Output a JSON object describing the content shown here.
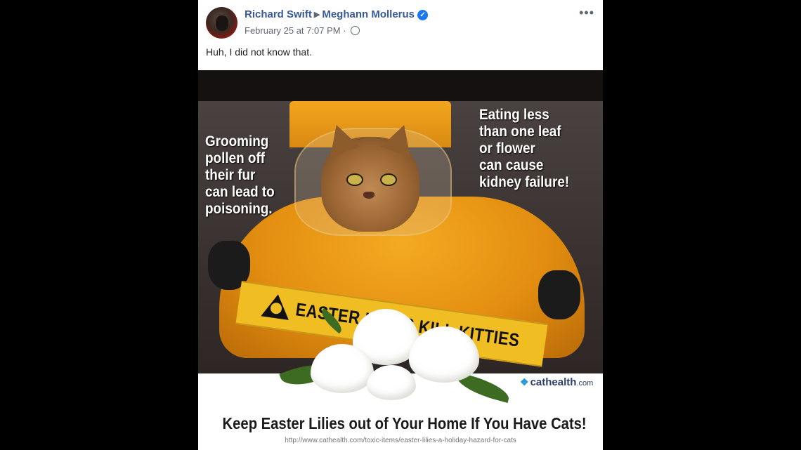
{
  "post": {
    "author": "Richard Swift",
    "target": "Meghann Mollerus",
    "timestamp": "February 25 at 7:07 PM",
    "separator": "·",
    "text": "Huh, I did not know that.",
    "more_label": "•••",
    "arrow": "▶",
    "verified_mark": "✓"
  },
  "image": {
    "left_caption": "Grooming\npollen off\ntheir fur\ncan lead to\npoisoning.",
    "right_caption": "Eating less\nthan one leaf\nor flower\ncan cause\nkidney failure!",
    "tape_text": "EASTER LILIES KILL KITTIES",
    "brand": "cathealth",
    "brand_suffix": ".com",
    "brand_icon": "paw-icon",
    "tagline": "Keep Easter Lilies out of Your Home If You Have Cats!",
    "url": "http://www.cathealth.com/toxic-items/easter-lilies-a-holiday-hazard-for-cats"
  },
  "colors": {
    "name_link": "#385898",
    "verified": "#1877f2",
    "meta_text": "#606770"
  }
}
